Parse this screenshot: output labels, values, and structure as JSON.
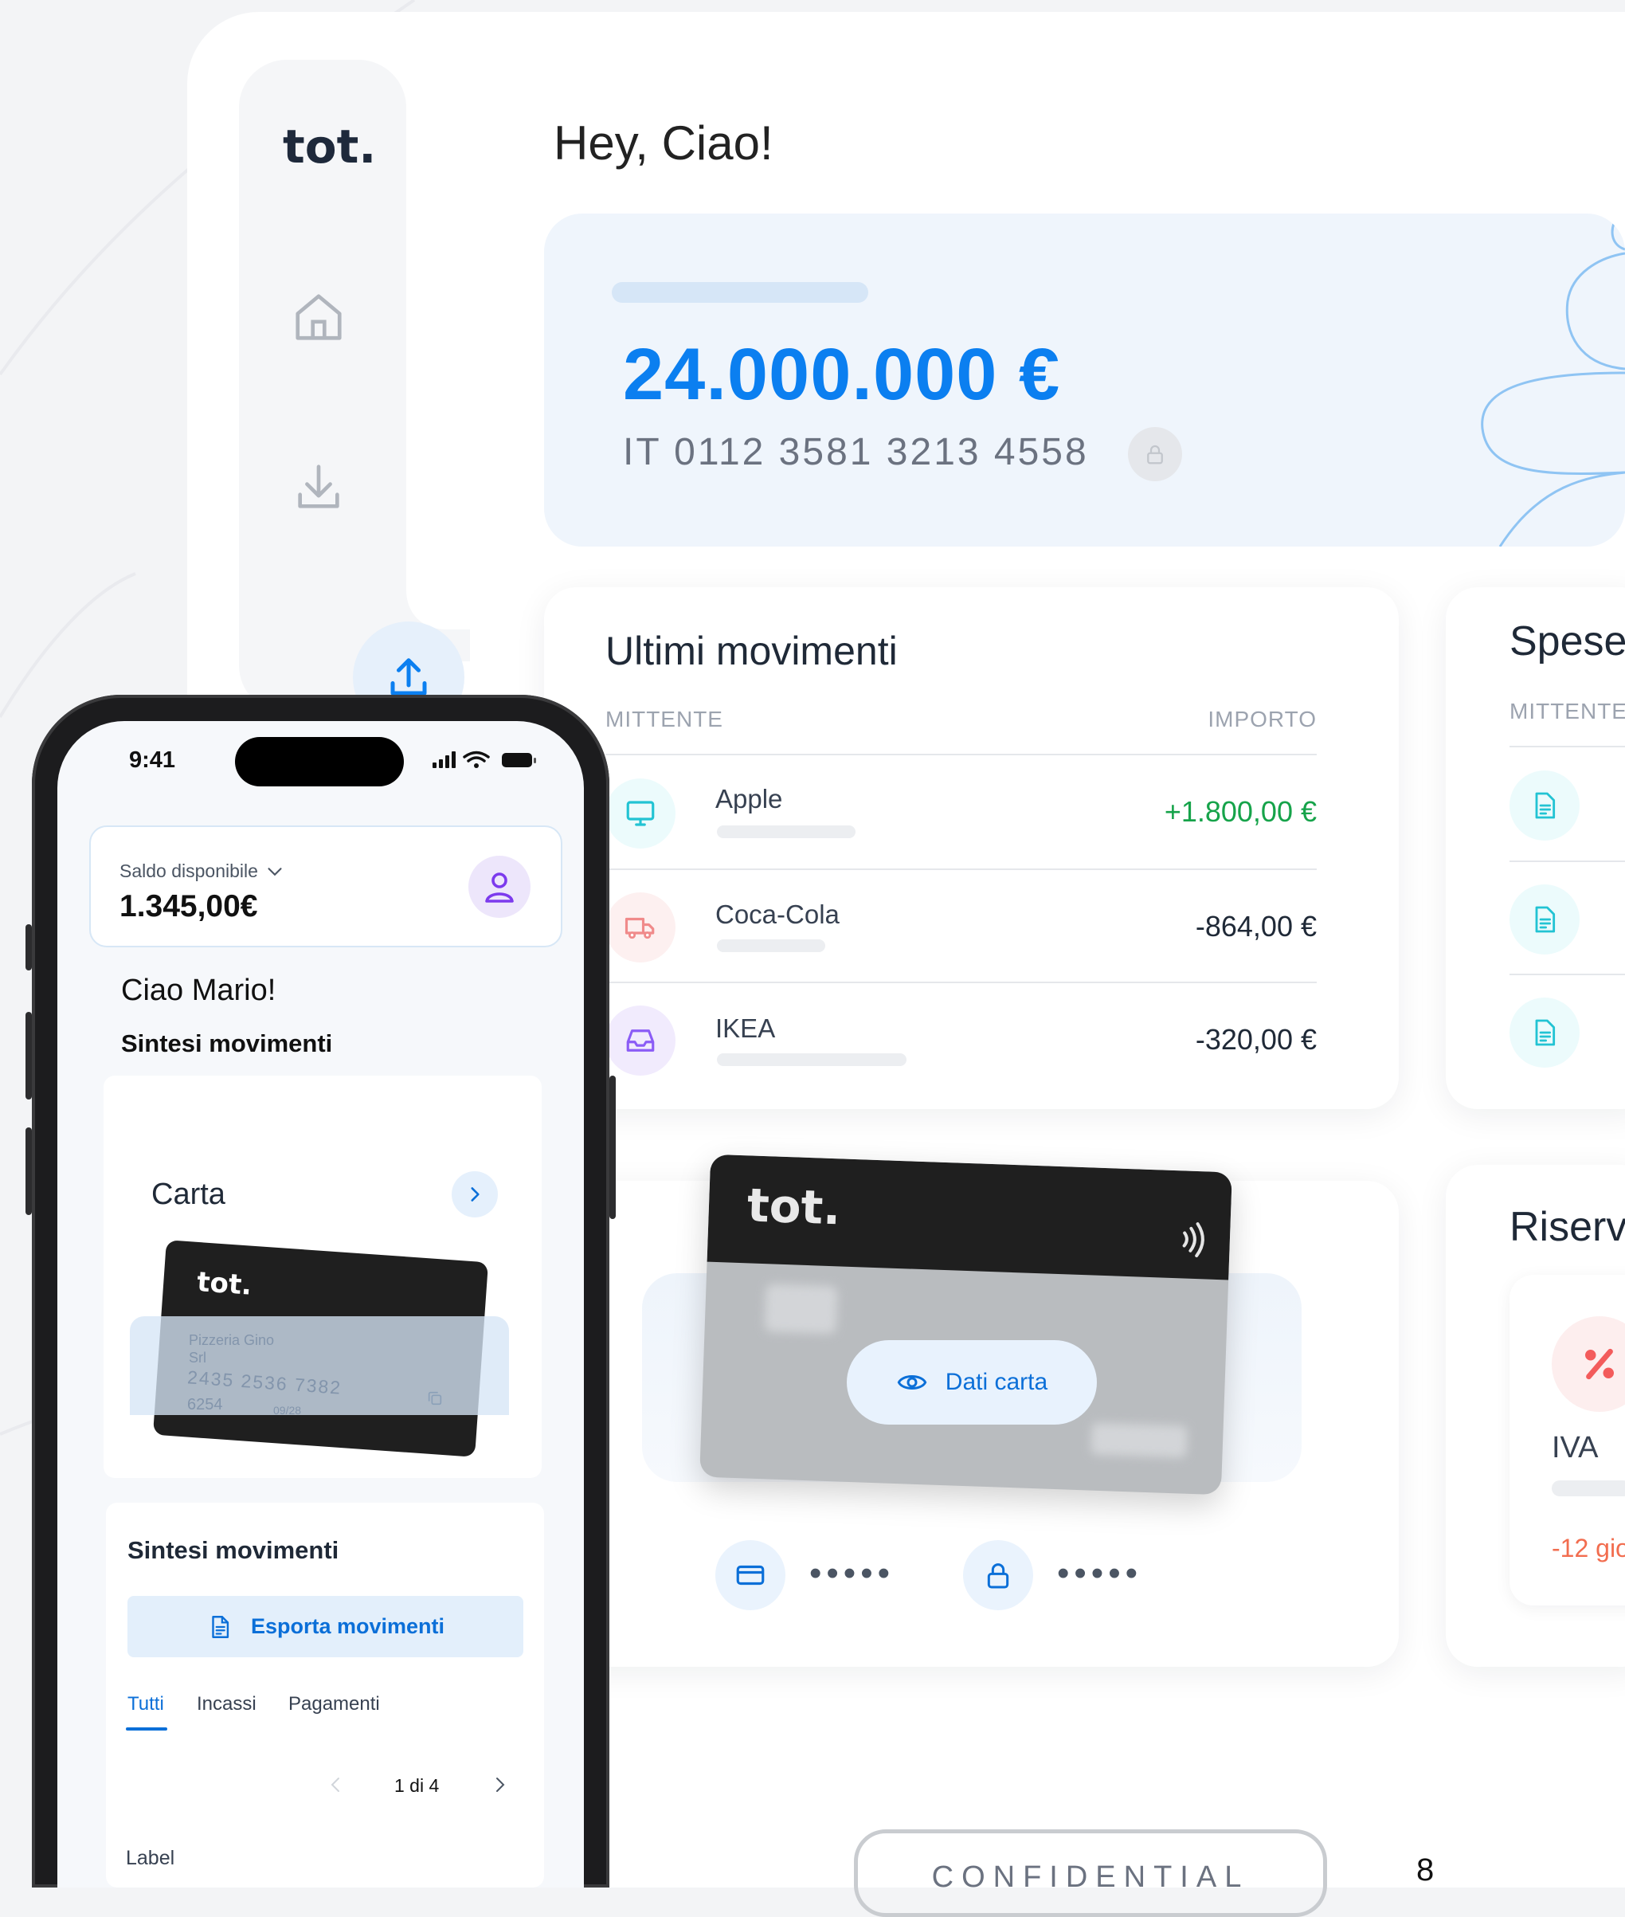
{
  "desktop": {
    "logo": "tot.",
    "greeting": "Hey, Ciao!",
    "balance": {
      "amount": "24.000.000 €",
      "iban": "IT 0112 3581 3213 4558"
    },
    "movements": {
      "title": "Ultimi movimenti",
      "col_sender": "MITTENTE",
      "col_amount": "IMPORTO",
      "rows": [
        {
          "name": "Apple",
          "amount": "+1.800,00 €",
          "icon": "monitor-icon"
        },
        {
          "name": "Coca-Cola",
          "amount": "-864,00 €",
          "icon": "truck-icon"
        },
        {
          "name": "IKEA",
          "amount": "-320,00 €",
          "icon": "inbox-icon"
        }
      ]
    },
    "expenses": {
      "title": "Spese",
      "col_sender": "MITTENTE"
    },
    "card": {
      "logo": "tot.",
      "details_button": "Dati carta",
      "masked_number": "•••••",
      "masked_pin": "•••••"
    },
    "reserves": {
      "title": "Riserv",
      "item_label": "IVA",
      "item_days": "-12 gio"
    },
    "footer": {
      "confidential": "CONFIDENTIAL",
      "page": "8"
    }
  },
  "phone": {
    "time": "9:41",
    "balance_label": "Saldo disponibile",
    "balance_value": "1.345,00€",
    "greeting": "Ciao Mario!",
    "summary_heading": "Sintesi movimenti",
    "card_title": "Carta",
    "card_logo": "tot.",
    "card_holder": "Pizzeria Gino",
    "card_holder_sub": "Srl",
    "card_number": "2435 2536 7382",
    "card_number_tail": "6254",
    "card_cvv_hint": "6254",
    "card_expiry": "09/28",
    "movements_heading": "Sintesi movimenti",
    "export_button": "Esporta movimenti",
    "tabs": [
      "Tutti",
      "Incassi",
      "Pagamenti"
    ],
    "pager": "1 di 4",
    "label": "Label"
  },
  "colors": {
    "accent": "#0b7ff0",
    "positive": "#16a34a",
    "dark_card": "#1f1f1f"
  }
}
